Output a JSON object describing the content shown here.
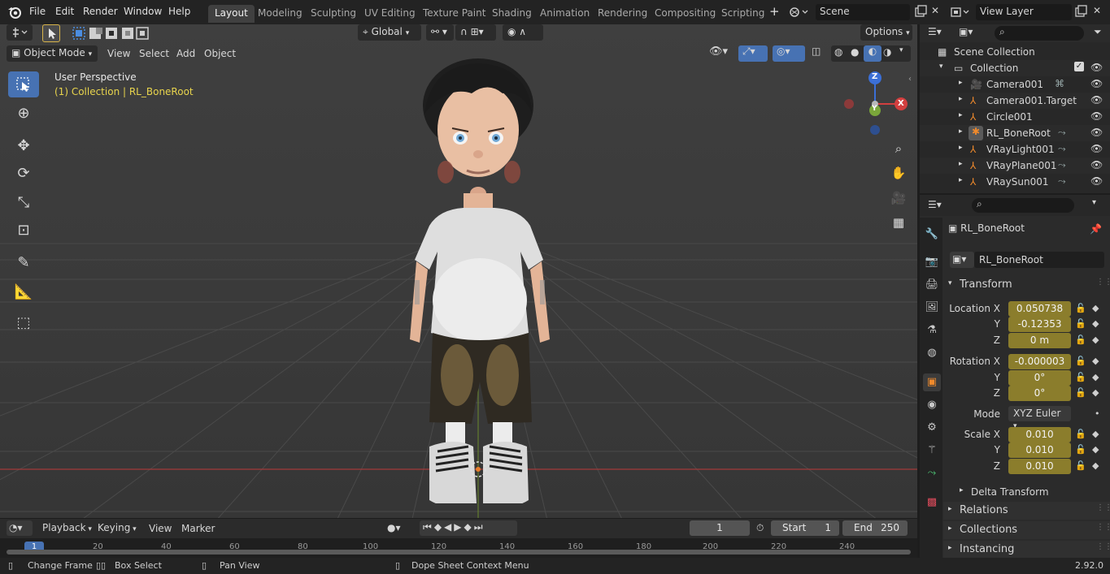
{
  "menu": {
    "items": [
      "File",
      "Edit",
      "Render",
      "Window",
      "Help"
    ],
    "workspace_tabs": [
      "Layout",
      "Modeling",
      "Sculpting",
      "UV Editing",
      "Texture Paint",
      "Shading",
      "Animation",
      "Rendering",
      "Compositing",
      "Scripting"
    ],
    "active_tab": "Layout",
    "add_tab_label": "+",
    "scene_name": "Scene",
    "view_layer_name": "View Layer"
  },
  "viewport": {
    "transform_orientation": "Global",
    "mode": "Object Mode",
    "header_menus": [
      "View",
      "Select",
      "Add",
      "Object"
    ],
    "options_label": "Options",
    "perspective_label": "User Perspective",
    "active_info": "(1) Collection | RL_BoneRoot",
    "gizmo_x": "X",
    "gizmo_y": "Y",
    "gizmo_z": "Z"
  },
  "outliner": {
    "scene_collection": "Scene Collection",
    "collection": "Collection",
    "objects": [
      "Camera001",
      "Camera001.Target",
      "Circle001",
      "RL_BoneRoot",
      "VRayLight001",
      "VRayPlane001",
      "VRaySun001"
    ]
  },
  "properties": {
    "object_name": "RL_BoneRoot",
    "data_name": "RL_BoneRoot",
    "transform_title": "Transform",
    "location": {
      "label": "Location X",
      "x": "0.050738",
      "y": "-0.12353",
      "z": "0 m"
    },
    "rotation": {
      "label": "Rotation X",
      "x": "-0.000003",
      "y": "0°",
      "z": "0°"
    },
    "axis_y": "Y",
    "axis_z": "Z",
    "mode_label": "Mode",
    "mode_value": "XYZ Euler",
    "scale": {
      "label": "Scale X",
      "x": "0.010",
      "y": "0.010",
      "z": "0.010"
    },
    "delta_transform": "Delta Transform",
    "collapsed_panels": [
      "Relations",
      "Collections",
      "Instancing"
    ]
  },
  "timeline": {
    "menus": [
      "Playback",
      "Keying",
      "View",
      "Marker"
    ],
    "current_frame": "1",
    "start_label": "Start",
    "start_value": "1",
    "end_label": "End",
    "end_value": "250",
    "ruler": [
      "1",
      "20",
      "40",
      "60",
      "80",
      "100",
      "120",
      "140",
      "160",
      "180",
      "200",
      "220",
      "240"
    ]
  },
  "statusbar": {
    "change_frame": "Change Frame",
    "box_select": "Box Select",
    "pan_view": "Pan View",
    "context_menu": "Dope Sheet Context Menu",
    "version": "2.92.0"
  },
  "colors": {
    "accent_blue": "#4772b3",
    "field_gold": "#8b7d2c",
    "active_text_yellow": "#e8d44d",
    "object_orange": "#f08a2c"
  }
}
